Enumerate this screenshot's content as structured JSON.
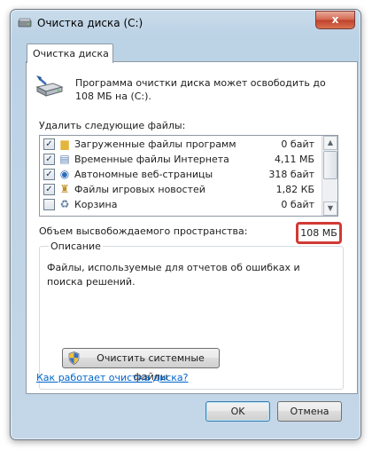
{
  "window": {
    "title": "Очистка диска  (C:)",
    "close_label": "x"
  },
  "tab": {
    "label": "Очистка диска"
  },
  "header": {
    "text": "Программа очистки диска может освободить до 108 МБ на  (C:)."
  },
  "files": {
    "label": "Удалить следующие файлы:",
    "items": [
      {
        "name": "Загруженные файлы программ",
        "size": "0 байт",
        "checked": true,
        "icon": "folder-icon"
      },
      {
        "name": "Временные файлы Интернета",
        "size": "4,11 МБ",
        "checked": true,
        "icon": "document-icon"
      },
      {
        "name": "Автономные веб-страницы",
        "size": "318 байт",
        "checked": true,
        "icon": "offline-web-icon"
      },
      {
        "name": "Файлы игровых новостей",
        "size": "1,82 КБ",
        "checked": true,
        "icon": "game-news-icon"
      },
      {
        "name": "Корзина",
        "size": "0 байт",
        "checked": false,
        "icon": "recycle-bin-icon"
      }
    ]
  },
  "space": {
    "label": "Объем высвобождаемого пространства:",
    "value": "108 МБ",
    "highlight_color": "#d23a34"
  },
  "description": {
    "title": "Описание",
    "text": "Файлы, используемые для отчетов об ошибках и поиска решений."
  },
  "buttons": {
    "clean_system": "Очистить системные файлы",
    "ok": "OK",
    "cancel": "Отмена"
  },
  "help_link": "Как работает очистка диска?"
}
